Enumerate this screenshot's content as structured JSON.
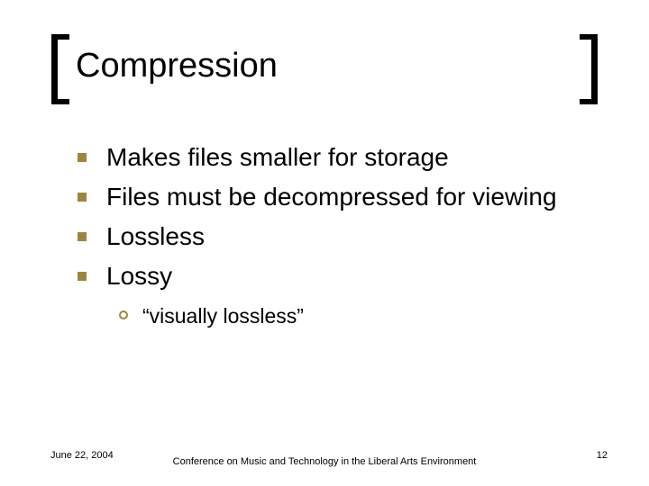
{
  "title": "Compression",
  "bullets": [
    {
      "text": "Makes files smaller for storage"
    },
    {
      "text": "Files must be decompressed for viewing"
    },
    {
      "text": "Lossless"
    },
    {
      "text": "Lossy",
      "sub": [
        {
          "text": "“visually lossless”"
        }
      ]
    }
  ],
  "footer": {
    "date": "June 22, 2004",
    "center": "Conference on Music and Technology in the Liberal Arts Environment",
    "page": "12"
  }
}
